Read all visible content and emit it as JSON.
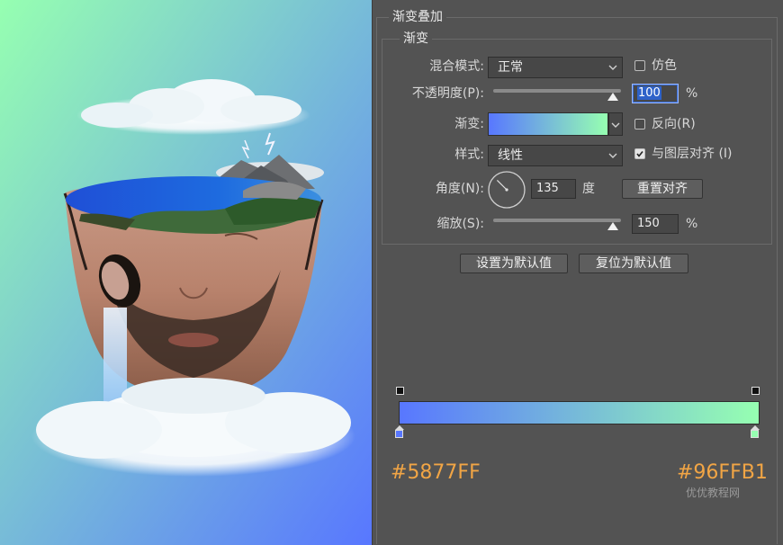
{
  "panel": {
    "section_title": "渐变叠加",
    "group_title": "渐变",
    "blend_mode": {
      "label": "混合模式:",
      "value": "正常"
    },
    "dither": {
      "label": "仿色",
      "checked": false
    },
    "opacity": {
      "label": "不透明度(P):",
      "value": "100",
      "unit": "%",
      "level": 1.0
    },
    "gradient": {
      "label": "渐变:"
    },
    "reverse": {
      "label": "反向(R)",
      "checked": false
    },
    "style": {
      "label": "样式:",
      "value": "线性"
    },
    "align_layer": {
      "label": "与图层对齐 (I)",
      "checked": true
    },
    "angle": {
      "label": "角度(N):",
      "value": "135",
      "unit": "度",
      "degrees": 135
    },
    "reset_align_button": "重置对齐",
    "scale": {
      "label": "缩放(S):",
      "value": "150",
      "unit": "%",
      "level": 1.0
    },
    "set_default_button": "设置为默认值",
    "reset_default_button": "复位为默认值"
  },
  "gradient_editor": {
    "start_color": "#5877FF",
    "end_color": "#96FFB1",
    "start_label": "#5877FF",
    "end_label": "#96FFB1"
  },
  "watermark": "优优教程网",
  "colors": {
    "panel_bg": "#535353",
    "accent_label": "#F1A545",
    "art_bg_top": "#96FFB1",
    "art_bg_bottom": "#5877FF"
  }
}
